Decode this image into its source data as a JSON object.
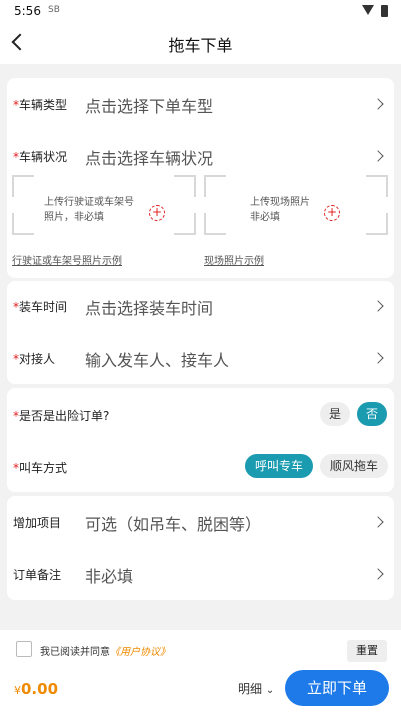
{
  "status_bar": {
    "time": "5:56",
    "sim_glyph": "SB"
  },
  "header": {
    "title": "拖车下单"
  },
  "vehicle": {
    "type_label": "车辆类型",
    "type_value": "点击选择下单车型",
    "condition_label": "车辆状况",
    "condition_value": "点击选择车辆状况",
    "upload1_line1": "上传行驶证或车架号",
    "upload1_line2": "照片，非必填",
    "upload2_line1": "上传现场照片",
    "upload2_line2": "非必填",
    "link1": "行驶证或车架号照片示例",
    "link2": "现场照片示例"
  },
  "loading": {
    "time_label": "装车时间",
    "time_value": "点击选择装车时间",
    "contact_label": "对接人",
    "contact_placeholder": "输入发车人、接车人"
  },
  "insurance": {
    "label": "是否是出险订单?",
    "yes": "是",
    "no": "否"
  },
  "call": {
    "label": "叫车方式",
    "option1": "呼叫专车",
    "option2": "顺风拖车"
  },
  "extra": {
    "label": "增加项目",
    "value": "可选（如吊车、脱困等）"
  },
  "remark": {
    "label": "订单备注",
    "value": "非必填"
  },
  "footer": {
    "agree_text": "我已阅读并同意",
    "agree_link": "《用户协议》",
    "reset": "重置",
    "currency": "¥",
    "price": "0.00",
    "detail": "明细",
    "submit": "立即下单"
  },
  "colors": {
    "accent": "#1e7ae8",
    "teal": "#1b9bb0",
    "orange": "#f08a00",
    "required": "#e02020"
  }
}
